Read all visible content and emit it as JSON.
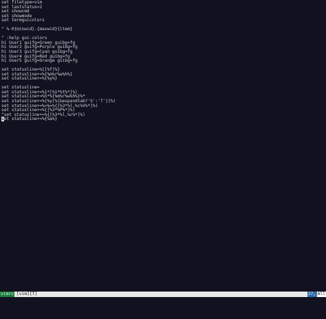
{
  "buffer": {
    "lines": [
      "set filetype=vim",
      "set laststatus=2",
      "set showcmd",
      "set showmode",
      "set termguicolors",
      "",
      "\" %-0{minwid}.{maxwid}{item}",
      "",
      "\" :help gui-colors",
      "hi User1 guifg=Green guibg=fg",
      "hi User2 guifg=Purple guibg=fg",
      "hi User3 guifg=Cyan guibg=fg",
      "hi User4 guifg=Red guibg=fg",
      "hi User5 guifg=Orange guibg=fg",
      "",
      "set statusline=%{[%f]%}",
      "set statusline+=%{%m%r%w%h%}",
      "set statusline+=%{%y%}",
      "",
      "set statusline=",
      "set statusline+=%1*[%1*%t%*]%)",
      "set statusline+=%5*%{%m%r%w%h%}%*",
      "set statusline+=%{%y[%{&expandtab?'S':'T'}]%)",
      "set statusline+=%=%=%{[%3*%l,%c%V%*]%)",
      "set statusline+=%{[%3*%P%*]%)",
      "\"set statusline+=%{[%3*%l,%c%*]%)",
      "set statusline+=%{%a%}"
    ],
    "cursor_line": 26,
    "cursor_char": "s"
  },
  "statusline": {
    "mode": "vimrc",
    "filetype": "[vim][T]",
    "position": "27,1",
    "percent": "All"
  },
  "colors": {
    "background": "#11111f",
    "foreground": "#cfcfdb",
    "statusbar": "#e8e8e8",
    "mode_bg": "#1d7f3d",
    "position_bg": "#2f6fa8"
  }
}
